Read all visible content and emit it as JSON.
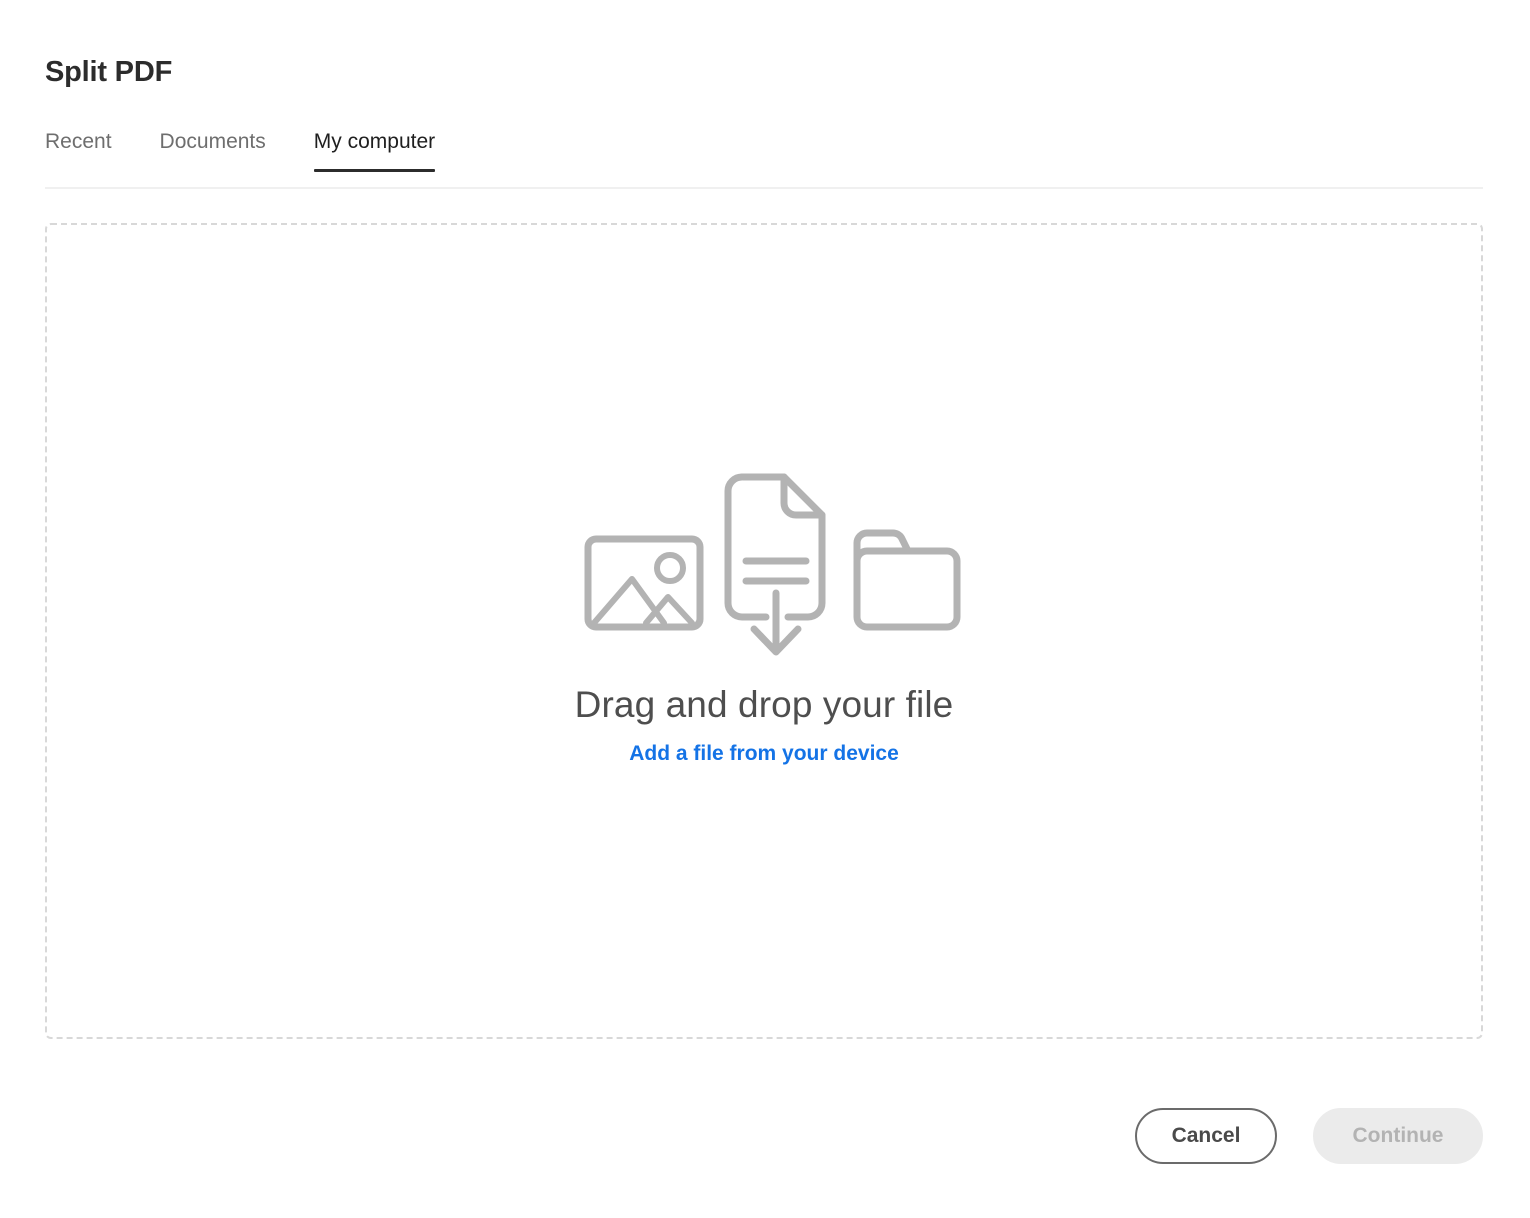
{
  "header": {
    "title": "Split PDF"
  },
  "tabs": [
    {
      "label": "Recent",
      "active": false
    },
    {
      "label": "Documents",
      "active": false
    },
    {
      "label": "My computer",
      "active": true
    }
  ],
  "dropzone": {
    "title": "Drag and drop your file",
    "link_label": "Add a file from your device",
    "icons": [
      "image-icon",
      "document-download-icon",
      "folder-icon"
    ]
  },
  "footer": {
    "cancel_label": "Cancel",
    "continue_label": "Continue",
    "continue_disabled": true
  },
  "colors": {
    "accent_blue": "#1473e6",
    "text_dark": "#2c2c2c",
    "text_muted": "#6e6e6e",
    "icon_gray": "#b3b3b3",
    "dashed_border": "#d8d8d8",
    "disabled_bg": "#ebebeb",
    "disabled_text": "#b3b3b3"
  }
}
